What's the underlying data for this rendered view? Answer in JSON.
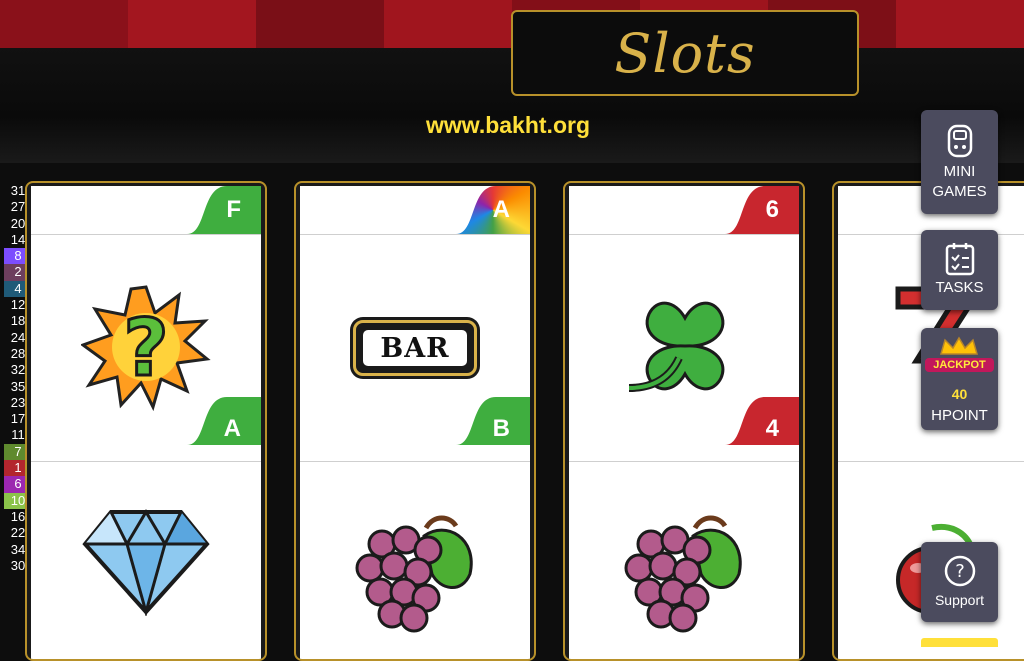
{
  "header": {
    "title": "Slots",
    "site_url": "www.bakht.org"
  },
  "legend": [
    {
      "value": "31",
      "color": ""
    },
    {
      "value": "27",
      "color": ""
    },
    {
      "value": "20",
      "color": ""
    },
    {
      "value": "14",
      "color": ""
    },
    {
      "value": "8",
      "color": "#7c4dff"
    },
    {
      "value": "2",
      "color": "#6d3e5e"
    },
    {
      "value": "4",
      "color": "#1f5a78"
    },
    {
      "value": "12",
      "color": ""
    },
    {
      "value": "18",
      "color": ""
    },
    {
      "value": "24",
      "color": ""
    },
    {
      "value": "28",
      "color": ""
    },
    {
      "value": "32",
      "color": ""
    },
    {
      "value": "35",
      "color": ""
    },
    {
      "value": "23",
      "color": ""
    },
    {
      "value": "17",
      "color": ""
    },
    {
      "value": "11",
      "color": ""
    },
    {
      "value": "7",
      "color": "#5f8a2e"
    },
    {
      "value": "1",
      "color": "#b3262e"
    },
    {
      "value": "6",
      "color": "#9c27b0"
    },
    {
      "value": "10",
      "color": "#8bc34a"
    },
    {
      "value": "16",
      "color": ""
    },
    {
      "value": "22",
      "color": ""
    },
    {
      "value": "34",
      "color": ""
    },
    {
      "value": "30",
      "color": ""
    }
  ],
  "reels": [
    {
      "top_tag": "F",
      "top_color": "green",
      "mid_symbol": "question-burst-icon",
      "mid_tag": "A",
      "mid_color": "green",
      "low_symbol": "diamond-icon"
    },
    {
      "top_tag": "A",
      "top_color": "rainbow",
      "mid_symbol": "bar-icon",
      "mid_tag": "B",
      "mid_color": "green",
      "low_symbol": "grapes-icon"
    },
    {
      "top_tag": "6",
      "top_color": "red",
      "mid_symbol": "clover-icon",
      "mid_tag": "4",
      "mid_color": "red",
      "low_symbol": "grapes-icon"
    },
    {
      "top_tag": "",
      "top_color": "",
      "mid_symbol": "seven-icon",
      "mid_tag": "",
      "mid_color": "",
      "low_symbol": "cherry-icon"
    }
  ],
  "bar_text": "BAR",
  "side_buttons": {
    "mini_games": {
      "line1": "MINI",
      "line2": "GAMES",
      "icon": "gamepad-icon"
    },
    "tasks": {
      "label": "TASKS",
      "icon": "clipboard-icon"
    },
    "jackpot": {
      "badge": "JACKPOT",
      "count": "40",
      "label": "HPOINT",
      "icon": "crown-icon"
    },
    "support": {
      "label": "Support",
      "icon": "question-circle-icon"
    }
  },
  "colors": {
    "gold": "#d9b24a",
    "url_yellow": "#ffe03a",
    "tag_green": "#3fae3f",
    "tag_red": "#c8262e",
    "button_bg": "#4b4b5e"
  }
}
